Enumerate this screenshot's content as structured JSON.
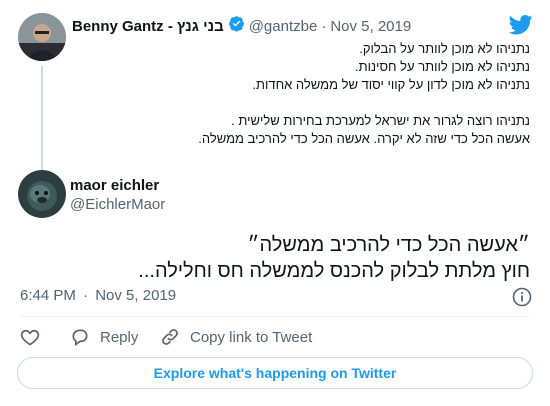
{
  "parent_tweet": {
    "display_name": "Benny Gantz - בני גנץ",
    "handle": "@gantzbe",
    "separator": "·",
    "date": "Nov 5, 2019",
    "text": "נתניהו לא מוכן לוותר על הבלוק.\nנתניהו לא מוכן לוותר על חסינות.\nנתניהו לא מוכן לדון על קווי יסוד של ממשלה אחדות.\n\nנתניהו רוצה לגרור את ישראל למערכת בחירות שלישית .\nאעשה הכל כדי שזה לא יקרה. אעשה הכל כדי להרכיב ממשלה."
  },
  "reply_tweet": {
    "display_name": "maor eichler",
    "handle": "@EichlerMaor",
    "text": "״אעשה הכל כדי להרכיב ממשלה״\nחוץ מלתת לבלוק להכנס לממשלה חס וחלילה...",
    "time": "6:44 PM",
    "separator": "·",
    "date": "Nov 5, 2019"
  },
  "actions": {
    "reply_label": "Reply",
    "copy_label": "Copy link to Tweet"
  },
  "explore_label": "Explore what's happening on Twitter",
  "colors": {
    "accent": "#1d9bf0",
    "verified": "#1d9bf0",
    "heart": "#536471"
  },
  "icons": [
    "twitter-bird-icon",
    "verified-badge-icon",
    "info-icon",
    "heart-icon",
    "reply-icon",
    "link-icon"
  ]
}
